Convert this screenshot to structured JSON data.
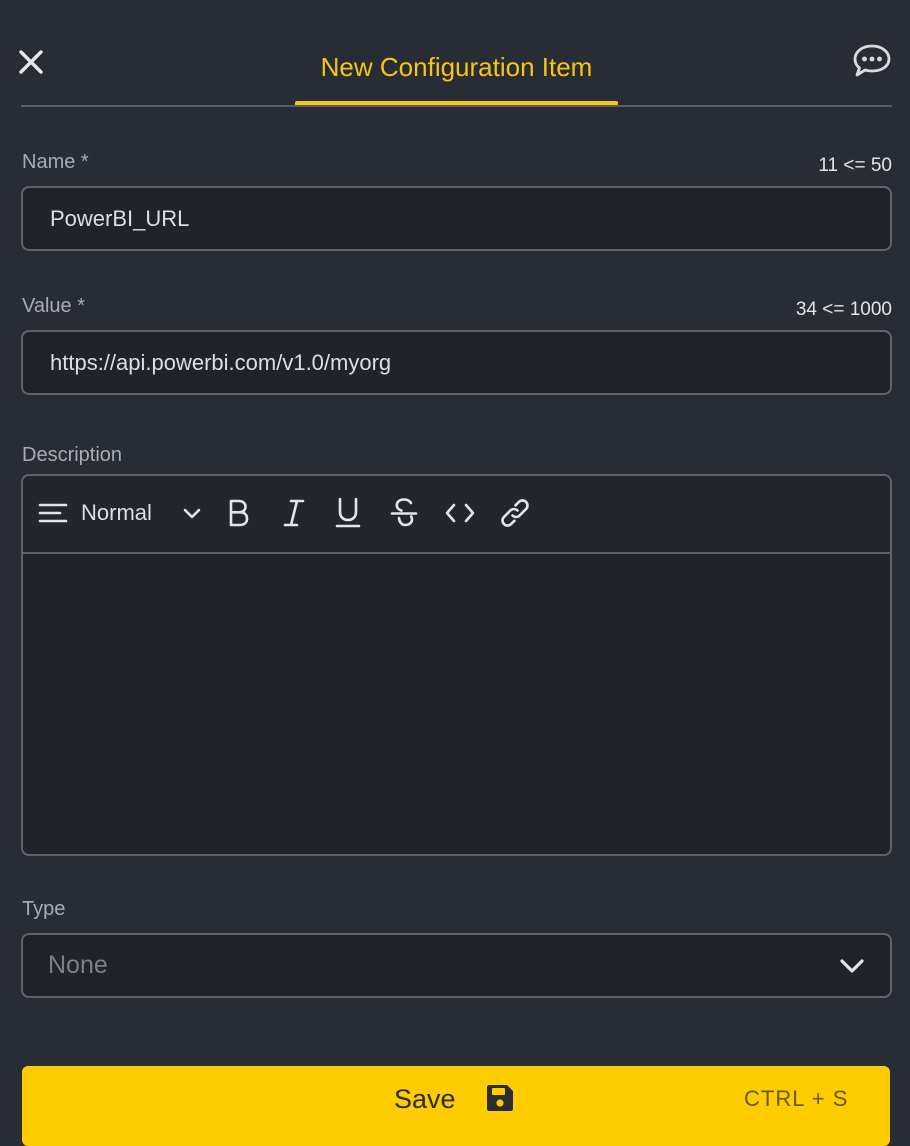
{
  "header": {
    "tab_label": "New Configuration Item",
    "close_icon": "close-icon",
    "chat_icon": "chat-bubble-icon"
  },
  "name_field": {
    "label": "Name *",
    "counter": "11 <= 50",
    "value": "PowerBI_URL"
  },
  "value_field": {
    "label": "Value *",
    "counter": "34 <= 1000",
    "value": "https://api.powerbi.com/v1.0/myorg"
  },
  "description": {
    "label": "Description",
    "format_value": "Normal",
    "toolbar_icons": [
      "align-icon",
      "chevron-down-icon",
      "bold-icon",
      "italic-icon",
      "underline-icon",
      "strikethrough-icon",
      "code-icon",
      "link-icon"
    ],
    "content": ""
  },
  "type_field": {
    "label": "Type",
    "value": "None"
  },
  "save": {
    "label": "Save",
    "shortcut": "CTRL + S"
  },
  "colors": {
    "background": "#282c34",
    "input_background": "#20242a",
    "accent": "#f5c518",
    "button": "#ffcc00",
    "border": "#5f646a"
  }
}
